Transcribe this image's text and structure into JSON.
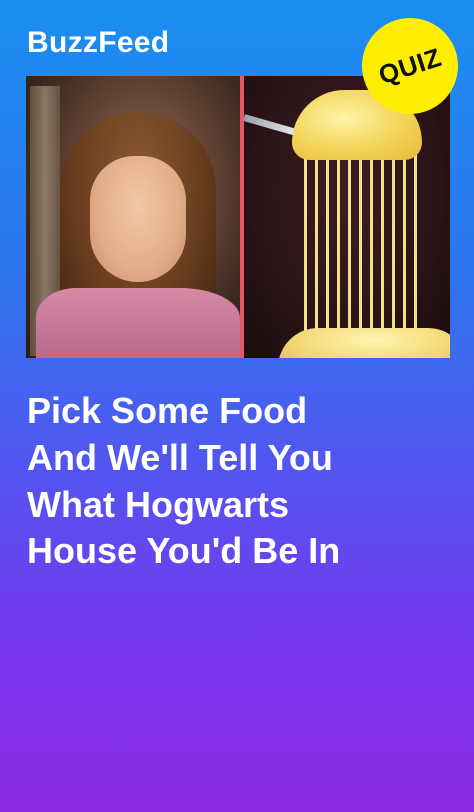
{
  "brand": {
    "logo_text": "BuzzFeed"
  },
  "badge": {
    "label": "QUIZ",
    "color": "#ffee00"
  },
  "images": {
    "left": "photo of a young woman in a pink dress with curled hair",
    "right": "forkful of macaroni and cheese with stretching cheese"
  },
  "headline": {
    "line1": "Pick Some Food",
    "line2": "And We'll Tell You",
    "line3": "What Hogwarts",
    "line4": "House You'd Be In"
  },
  "colors": {
    "gradient_top": "#1a8ff0",
    "gradient_bottom": "#8a2be2",
    "divider": "#e8566c",
    "text": "#ffffff"
  }
}
